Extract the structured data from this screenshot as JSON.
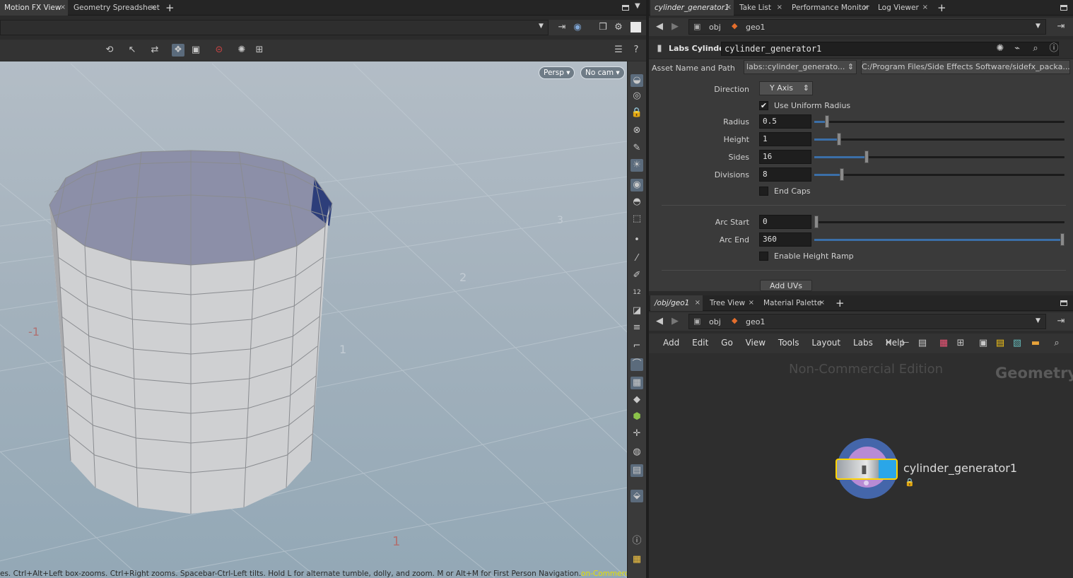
{
  "left_tabs": [
    "Motion FX View",
    "Geometry Spreadsheet"
  ],
  "right_top_tabs": [
    "cylinder_generator1",
    "Take List",
    "Performance Monitor",
    "Log Viewer"
  ],
  "path_top": {
    "obj": "obj",
    "geo": "geo1"
  },
  "viewport": {
    "persp": "Persp",
    "cam": "No cam",
    "status": "es. Ctrl+Alt+Left box-zooms. Ctrl+Right zooms. Spacebar-Ctrl-Left tilts. Hold L for alternate tumble, dolly, and zoom.   M or Alt+M for First Person Navigation.",
    "status_accent": "on-Commercial Edition",
    "grid_labels": [
      "-1",
      "1",
      "2",
      "3",
      "1"
    ]
  },
  "node_header": {
    "type": "Labs Cylinder",
    "name": "cylinder_generator1"
  },
  "asset": {
    "label": "Asset Name and Path",
    "name": "labs::cylinder_generato...",
    "path": "C:/Program Files/Side Effects Software/sidefx_packa..."
  },
  "params": {
    "direction_label": "Direction",
    "direction_value": "Y Axis",
    "uniform_label": "Use Uniform Radius",
    "uniform_checked": "✔",
    "radius_label": "Radius",
    "radius": "0.5",
    "radius_frac": 0.05,
    "height_label": "Height",
    "height": "1",
    "height_frac": 0.1,
    "sides_label": "Sides",
    "sides": "16",
    "sides_frac": 0.21,
    "divisions_label": "Divisions",
    "divisions": "8",
    "divisions_frac": 0.11,
    "endcaps_label": "End Caps",
    "arcstart_label": "Arc Start",
    "arcstart": "0",
    "arcstart_frac": 0.0,
    "arcend_label": "Arc End",
    "arcend": "360",
    "arcend_frac": 1.0,
    "ramp_label": "Enable Height Ramp",
    "adduvs": "Add UVs"
  },
  "net_tabs": [
    "/obj/geo1",
    "Tree View",
    "Material Palette"
  ],
  "path_bottom": {
    "obj": "obj",
    "geo": "geo1"
  },
  "net_menu": [
    "Add",
    "Edit",
    "Go",
    "View",
    "Tools",
    "Layout",
    "Labs",
    "Help"
  ],
  "network": {
    "watermark": "Non-Commercial Edition",
    "context": "Geometry",
    "node_name": "cylinder_generator1"
  },
  "colors": {
    "accent": "#3b6fa8",
    "node_ring": "#4466aa",
    "node_select": "#ffd400"
  }
}
